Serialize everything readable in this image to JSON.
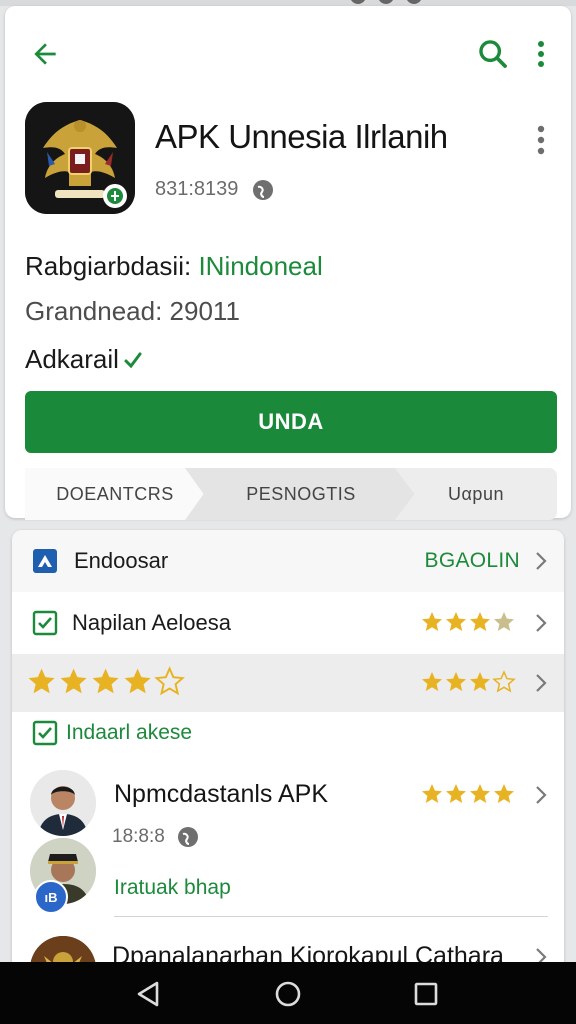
{
  "colors": {
    "accent": "#1a8a3a",
    "star": "#e8b322",
    "text": "#1b1b1b",
    "muted": "#6b6b6b"
  },
  "toolbar": {
    "back_icon": "arrow-back-icon",
    "search_icon": "search-icon",
    "more_icon": "more-vert-icon"
  },
  "app": {
    "title": "APK Unnesia Ilrlanih",
    "meta": "831:8139",
    "developer_prefix": "Rabgiarbdasii: ",
    "developer_link": "INindoneal",
    "size_line": "Grandnead: 29011",
    "availability": "Adkarail",
    "install_label": "UNDA"
  },
  "tabs": [
    {
      "label": "DOEANTCRS"
    },
    {
      "label": "PESNOGTIS"
    },
    {
      "label": "Uαpun"
    }
  ],
  "list": {
    "row1": {
      "label": "Endoosar",
      "right_label": "BGAOLIN"
    },
    "row2": {
      "label": "Napilan Aeloesa",
      "rating": 3.5
    },
    "row3": {
      "left_rating": 4.5,
      "rating": 3.5
    },
    "section_label": "Indaarl akese",
    "review1": {
      "title": "Npmcdastanls APK",
      "rating": 4,
      "meta": "18:8:8"
    },
    "review2": {
      "badge": "ıB",
      "text": "Iratuak bhap"
    },
    "review3": {
      "title": "Dpanalanarhan Kiorokapul Cathara"
    }
  }
}
